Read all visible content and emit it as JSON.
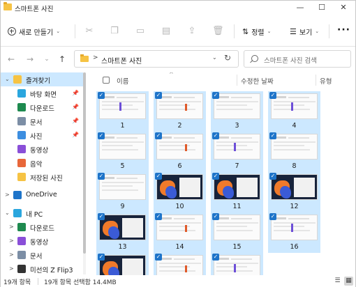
{
  "window": {
    "title": "스마트폰 사진",
    "minimize_glyph": "—",
    "maximize_glyph": "☐",
    "close_glyph": "✕"
  },
  "toolbar": {
    "new_label": "새로 만들기",
    "sort_label": "정렬",
    "view_label": "보기",
    "more_glyph": "···",
    "icons": [
      "cut-icon",
      "copy-icon",
      "paste-icon",
      "rename-icon",
      "share-icon",
      "delete-icon"
    ]
  },
  "nav": {
    "back_glyph": "←",
    "forward_glyph": "→",
    "recent_glyph": "⌄",
    "up_glyph": "↑",
    "breadcrumb_sep": ">",
    "address": "스마트폰 사진",
    "address_dropdown_glyph": "⌄",
    "refresh_glyph": "↻",
    "search_placeholder": "스마트폰 사진 검색"
  },
  "sidebar": {
    "quick_access": {
      "toggle": "⌄",
      "label": "즐겨찾기",
      "icon": "star-icon",
      "color": "#f6c344"
    },
    "quick_items": [
      {
        "label": "바탕 화면",
        "icon": "desktop-icon",
        "color": "#2aa6de",
        "pinned": true
      },
      {
        "label": "다운로드",
        "icon": "download-icon",
        "color": "#1e8a4f",
        "pinned": true
      },
      {
        "label": "문서",
        "icon": "documents-icon",
        "color": "#7c8ea5",
        "pinned": true
      },
      {
        "label": "사진",
        "icon": "pictures-icon",
        "color": "#3d8ee0",
        "pinned": true
      },
      {
        "label": "동영상",
        "icon": "videos-icon",
        "color": "#8a4fd8",
        "pinned": false
      },
      {
        "label": "음악",
        "icon": "music-icon",
        "color": "#e8673a",
        "pinned": false
      },
      {
        "label": "저장된 사진",
        "icon": "folder-icon",
        "color": "#f6c344",
        "pinned": false
      }
    ],
    "pin_glyph": "📌",
    "onedrive": {
      "toggle": ">",
      "label": "OneDrive",
      "icon": "onedrive-icon",
      "color": "#1e74c9"
    },
    "this_pc": {
      "toggle": "⌄",
      "label": "내 PC",
      "icon": "pc-icon",
      "color": "#2aa6de"
    },
    "pc_items": [
      {
        "toggle": ">",
        "label": "다운로드",
        "icon": "download-icon",
        "color": "#1e8a4f"
      },
      {
        "toggle": ">",
        "label": "동영상",
        "icon": "videos-icon",
        "color": "#8a4fd8"
      },
      {
        "toggle": ">",
        "label": "문서",
        "icon": "documents-icon",
        "color": "#7c8ea5"
      },
      {
        "toggle": ">",
        "label": "미선의 Z Flip3",
        "icon": "phone-icon",
        "color": "#333333"
      }
    ]
  },
  "content": {
    "columns": {
      "name": "이름",
      "date": "수정한 날짜",
      "type": "유형"
    },
    "sort_glyph": "^",
    "check_glyph": "✓",
    "items": [
      {
        "label": "1",
        "dark": false
      },
      {
        "label": "2",
        "dark": false
      },
      {
        "label": "3",
        "dark": false
      },
      {
        "label": "4",
        "dark": false
      },
      {
        "label": "5",
        "dark": false
      },
      {
        "label": "6",
        "dark": false
      },
      {
        "label": "7",
        "dark": false
      },
      {
        "label": "8",
        "dark": false
      },
      {
        "label": "9",
        "dark": false
      },
      {
        "label": "10",
        "dark": true
      },
      {
        "label": "11",
        "dark": true
      },
      {
        "label": "12",
        "dark": true
      },
      {
        "label": "13",
        "dark": true
      },
      {
        "label": "14",
        "dark": false
      },
      {
        "label": "15",
        "dark": false
      },
      {
        "label": "16",
        "dark": false
      },
      {
        "label": "",
        "dark": true
      },
      {
        "label": "",
        "dark": false
      },
      {
        "label": "",
        "dark": false
      }
    ],
    "accent": "#cce8ff",
    "check_color": "#1e74c9"
  },
  "status": {
    "count": "19개 항목",
    "selection": "19개 항목 선택함 14.4MB",
    "details_view_glyph": "☰",
    "tiles_view_glyph": "▦"
  }
}
